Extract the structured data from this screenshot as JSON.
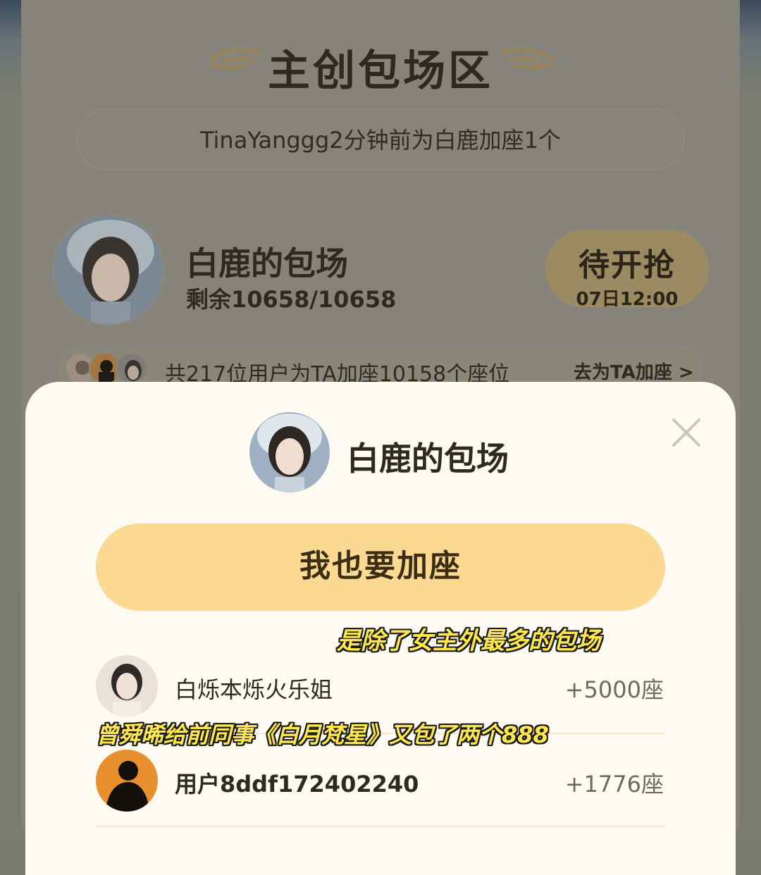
{
  "section": {
    "title": "主创包场区",
    "ticker": "TinaYanggg2分钟前为白鹿加座1个"
  },
  "host": {
    "name": "白鹿的包场",
    "remaining": "剩余10658/10658",
    "status_label": "待开抢",
    "status_time": "07日12:00"
  },
  "summary": {
    "text": "共217位用户为TA加座10158个座位",
    "link": "去为TA加座 >"
  },
  "sheet": {
    "title": "白鹿的包场",
    "join_button": "我也要加座",
    "close_icon": "close-icon"
  },
  "captions": [
    "是除了女主外最多的包场",
    "曾舜晞给前同事《白月梵星》又包了两个888"
  ],
  "contributors": [
    {
      "name": "白烁本烁火乐姐",
      "seats": "+5000座"
    },
    {
      "name": "用户8ddf172402240",
      "seats": "+1776座"
    }
  ],
  "colors": {
    "join_button": "#fbd993",
    "sheet_bg": "#fdfbf1",
    "caption_yellow": "#fde74c"
  }
}
